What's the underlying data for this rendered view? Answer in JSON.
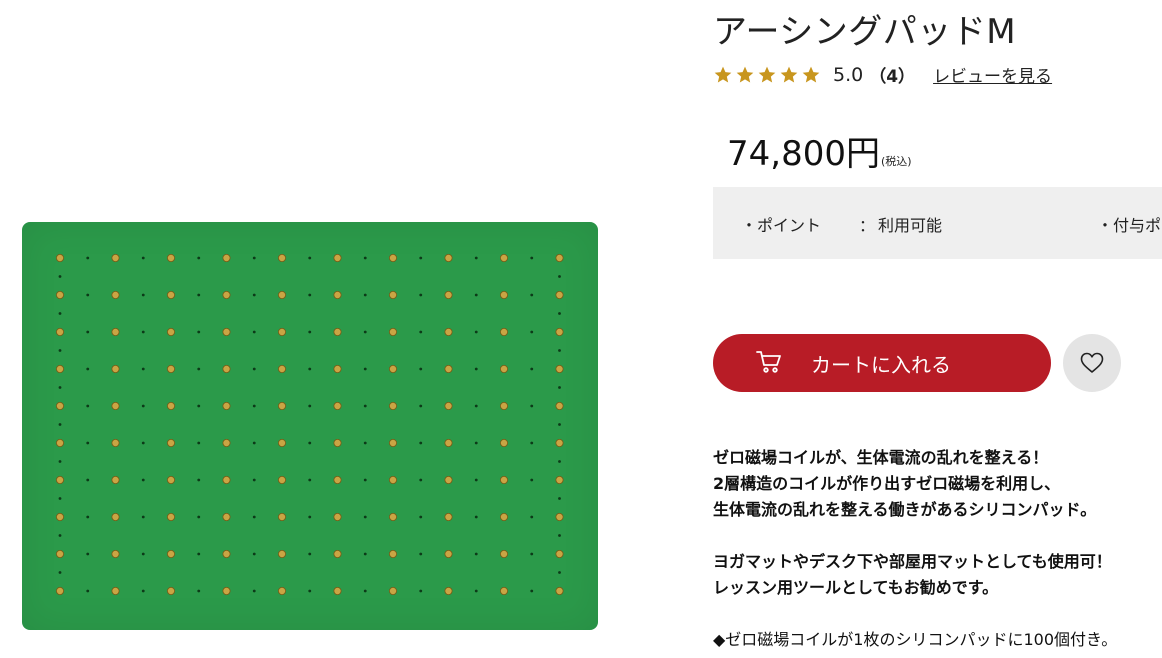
{
  "product": {
    "title": "アーシングパッドM",
    "rating": {
      "score": "5.0",
      "count": "（4）",
      "stars": 5,
      "review_link": "レビューを見る",
      "star_color": "#c8961e"
    },
    "price": {
      "amount": "74,800円",
      "tax_note": "(税込)"
    },
    "points": {
      "label": "・ポイント",
      "separator": "：",
      "value": "利用可能",
      "extra": "・付与ポ"
    },
    "cart_button": {
      "label": "カートに入れる",
      "icon": "cart-icon",
      "color": "#b81c26"
    },
    "favorite_icon": "heart-icon",
    "image": {
      "pad_color": "#2b9a4a",
      "coil_color": "#c9a544"
    }
  },
  "description": {
    "line1": "ゼロ磁場コイルが、生体電流の乱れを整える！",
    "line2": "2層構造のコイルが作り出すゼロ磁場を利用し、",
    "line3": "生体電流の乱れを整える働きがあるシリコンパッド。",
    "line4": "ヨガマットやデスク下や部屋用マットとしても使用可！",
    "line5": "レッスン用ツールとしてもお勧めです。",
    "line6": "◆ゼロ磁場コイルが1枚のシリコンパッドに100個付き。"
  }
}
